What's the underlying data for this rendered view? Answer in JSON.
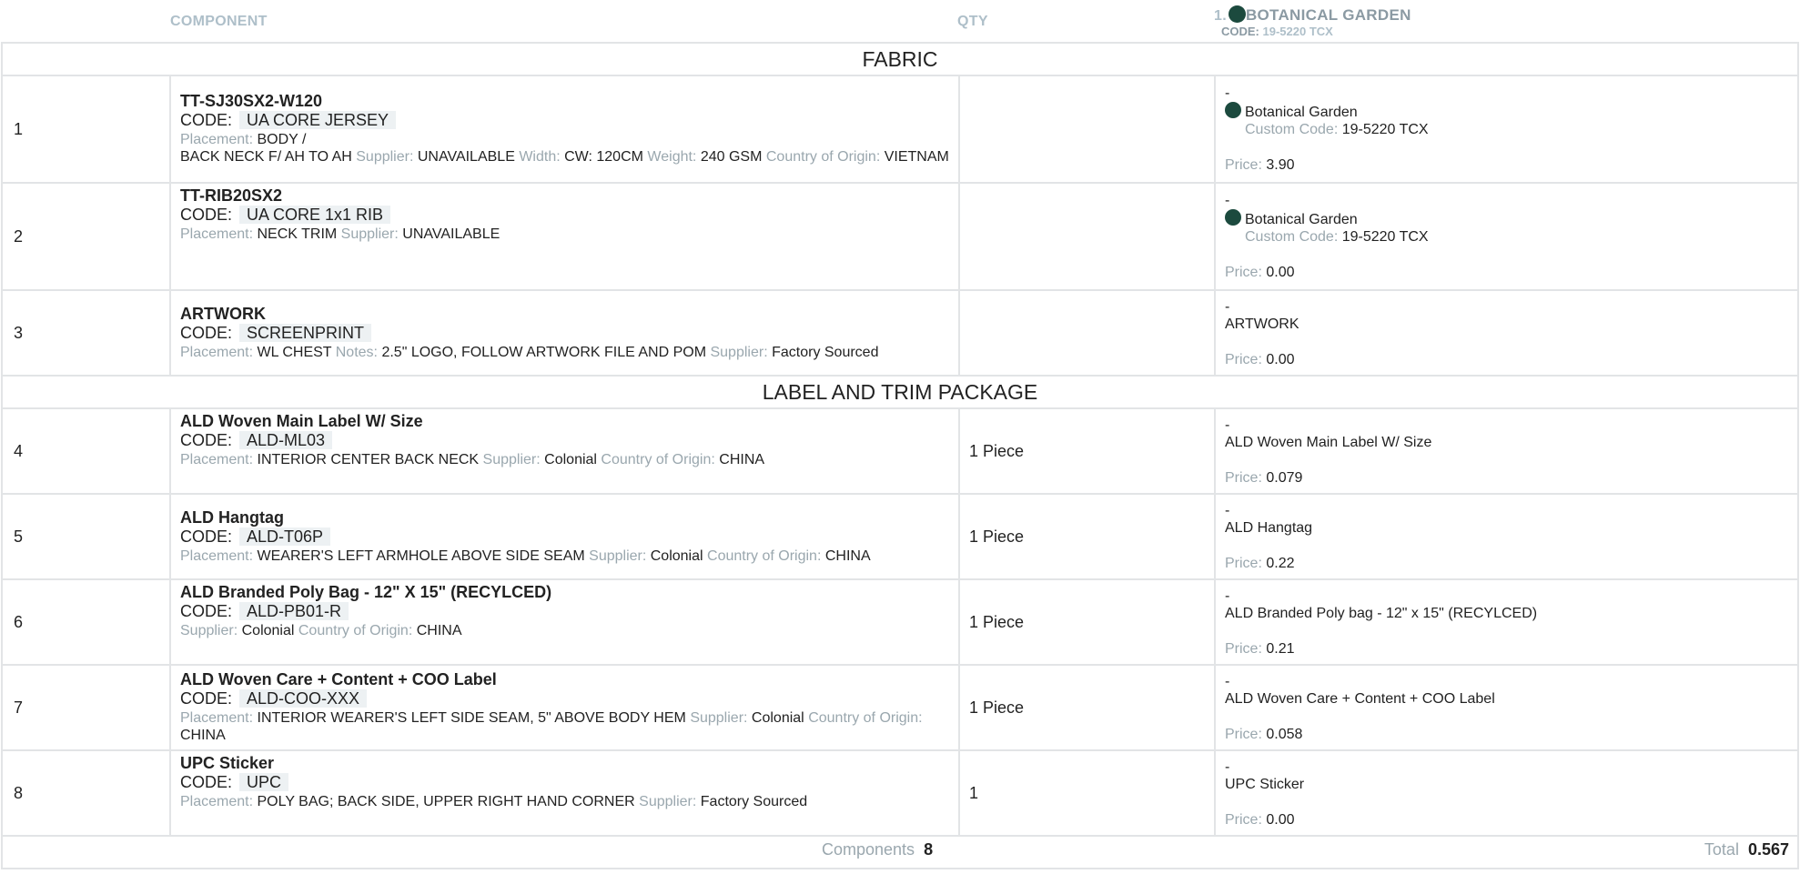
{
  "header": {
    "component": "COMPONENT",
    "qty": "QTY",
    "colorway_number": "1.",
    "colorway_name": "BOTANICAL GARDEN",
    "code_label": "CODE:",
    "code_value": "19-5220 TCX",
    "swatch_color": "#1c4a3e"
  },
  "sections": {
    "fabric": "FABRIC",
    "trim": "LABEL AND TRIM PACKAGE"
  },
  "labels": {
    "code": "CODE:",
    "placement": "Placement:",
    "supplier": "Supplier:",
    "width": "Width:",
    "weight": "Weight:",
    "origin": "Country of Origin:",
    "notes": "Notes:",
    "custom_code": "Custom Code:",
    "price": "Price:",
    "dash": "-"
  },
  "rows": [
    {
      "num": "1",
      "name": "TT-SJ30SX2-W120",
      "code": "UA CORE JERSEY",
      "placement": "BODY /",
      "placement2": "BACK NECK F/ AH TO AH",
      "supplier": "UNAVAILABLE",
      "width": "CW: 120CM",
      "weight": "240 GSM",
      "origin": "VIETNAM",
      "qty": "",
      "color_name": "Botanical Garden",
      "custom_code": "19-5220 TCX",
      "price": "3.90"
    },
    {
      "num": "2",
      "name": "TT-RIB20SX2",
      "code": "UA CORE 1x1 RIB",
      "placement": "NECK TRIM",
      "supplier": "UNAVAILABLE",
      "qty": "",
      "color_name": "Botanical Garden",
      "custom_code": "19-5220 TCX",
      "price": "0.00"
    },
    {
      "num": "3",
      "name": "ARTWORK",
      "code": "SCREENPRINT",
      "placement": "WL CHEST",
      "notes": "2.5\" LOGO, FOLLOW ARTWORK FILE AND POM",
      "supplier": "Factory Sourced",
      "qty": "",
      "color_text": "ARTWORK",
      "price": "0.00"
    },
    {
      "num": "4",
      "name": "ALD Woven Main Label W/ Size",
      "code": "ALD-ML03",
      "placement": "INTERIOR CENTER BACK NECK",
      "supplier": "Colonial",
      "origin": "CHINA",
      "qty": "1 Piece",
      "color_text": "ALD Woven Main Label W/ Size",
      "price": "0.079"
    },
    {
      "num": "5",
      "name": "ALD Hangtag",
      "code": "ALD-T06P",
      "placement": "WEARER'S LEFT ARMHOLE ABOVE SIDE SEAM",
      "supplier": "Colonial",
      "origin": "CHINA",
      "qty": "1 Piece",
      "color_text": "ALD Hangtag",
      "price": "0.22"
    },
    {
      "num": "6",
      "name": "ALD Branded Poly Bag - 12\" X 15\" (RECYLCED)",
      "code": "ALD-PB01-R",
      "supplier": "Colonial",
      "origin": "CHINA",
      "qty": "1 Piece",
      "color_text": "ALD Branded Poly bag - 12\" x 15\" (RECYLCED)",
      "price": "0.21"
    },
    {
      "num": "7",
      "name": "ALD Woven Care + Content + COO Label",
      "code": "ALD-COO-XXX",
      "placement": "INTERIOR WEARER'S LEFT SIDE SEAM, 5\" ABOVE BODY HEM",
      "supplier": "Colonial",
      "origin": "CHINA",
      "qty": "1 Piece",
      "color_text": "ALD Woven Care + Content + COO Label",
      "price": "0.058"
    },
    {
      "num": "8",
      "name": "UPC Sticker",
      "code": "UPC",
      "placement": "POLY BAG; BACK SIDE, UPPER RIGHT HAND CORNER",
      "supplier": "Factory Sourced",
      "qty": "1",
      "color_text": "UPC Sticker",
      "price": "0.00"
    }
  ],
  "footer": {
    "components_label": "Components",
    "components_count": "8",
    "total_label": "Total",
    "total_value": "0.567"
  }
}
